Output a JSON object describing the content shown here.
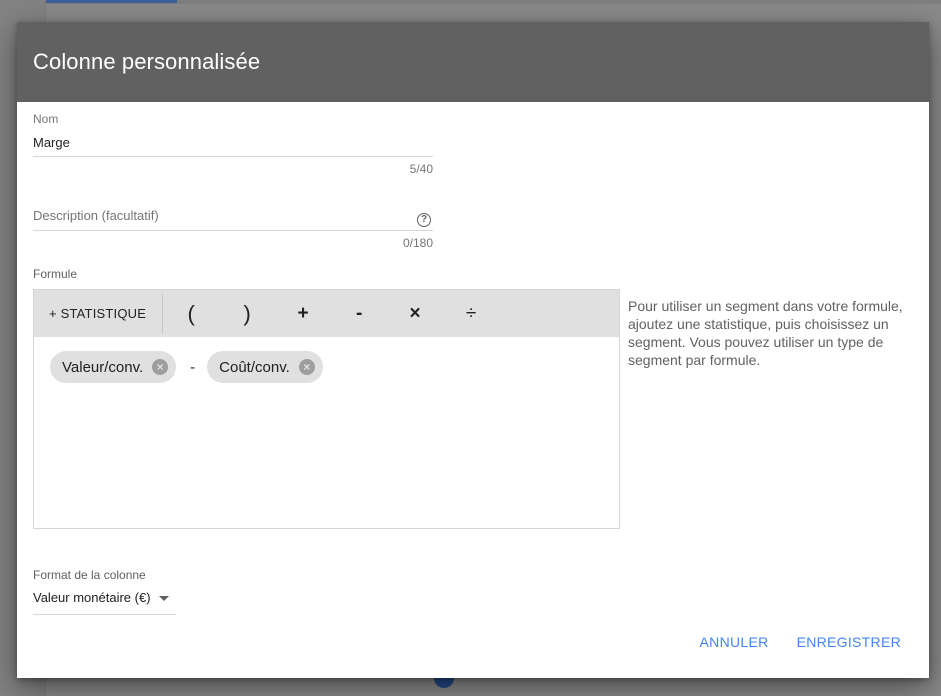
{
  "dialog": {
    "title": "Colonne personnalisée"
  },
  "name_field": {
    "label": "Nom",
    "value": "Marge",
    "counter": "5/40"
  },
  "description_field": {
    "placeholder": "Description (facultatif)",
    "counter": "0/180",
    "help_icon": "help-circle-icon"
  },
  "formula": {
    "label": "Formule",
    "toolbar": {
      "add_stat_label": "+ STATISTIQUE",
      "operators": [
        "(",
        ")",
        "+",
        "-",
        "×",
        "÷"
      ]
    },
    "tokens": {
      "chip1": "Valeur/conv.",
      "operator": "-",
      "chip2": "Coût/conv."
    },
    "help_text": "Pour utiliser un segment dans votre formule, ajoutez une statistique, puis choisissez un segment. Vous pouvez utiliser un type de segment par formule."
  },
  "column_format": {
    "label": "Format de la colonne",
    "value": "Valeur monétaire (€)"
  },
  "actions": {
    "cancel_label": "ANNULER",
    "save_label": "ENREGISTRER"
  },
  "colors": {
    "header_bg": "#616161",
    "accent": "#4285f4",
    "toolbar_bg": "#e0e0e0"
  }
}
